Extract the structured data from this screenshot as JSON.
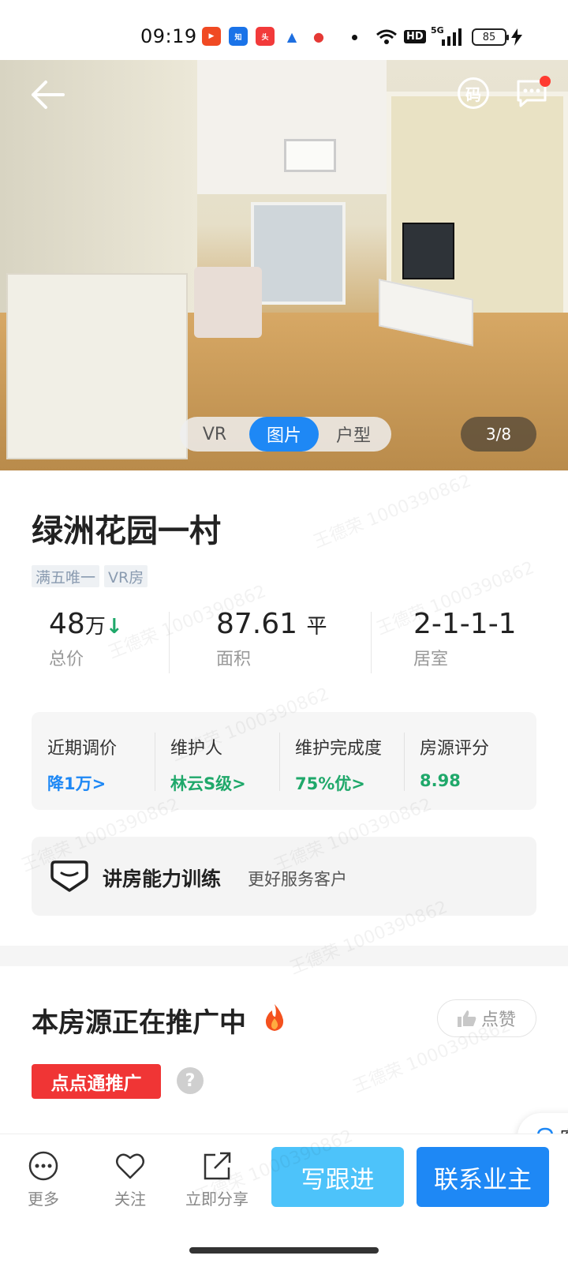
{
  "status_bar": {
    "time": "09:19",
    "app_icons": [
      "video-icon",
      "zhihu-icon",
      "toutiao-icon",
      "a-icon",
      "map-pin-icon"
    ],
    "network": "HD",
    "signal": "5G",
    "battery": "85"
  },
  "gallery": {
    "tabs": [
      "VR",
      "图片",
      "户型"
    ],
    "active_tab": "图片",
    "counter": "3/8",
    "qr_label": "码"
  },
  "listing": {
    "title": "绿洲花园一村",
    "tags": [
      "满五唯一",
      "VR房"
    ],
    "price": {
      "value": "48",
      "unit": "万",
      "label": "总价"
    },
    "area": {
      "value": "87.61",
      "unit": "平",
      "label": "面积"
    },
    "layout": {
      "value": "2-1-1-1",
      "label": "居室"
    }
  },
  "info_card": [
    {
      "label": "近期调价",
      "value": "降1万>",
      "color": "#1e88f5"
    },
    {
      "label": "维护人",
      "value": "林云S级>",
      "color": "#1fa86a"
    },
    {
      "label": "维护完成度",
      "value": "75%优>",
      "color": "#1fa86a"
    },
    {
      "label": "房源评分",
      "value": "8.98",
      "color": "#1fa86a"
    }
  ],
  "training": {
    "title": "讲房能力训练",
    "subtitle": "更好服务客户"
  },
  "promotion": {
    "title": "本房源正在推广中",
    "like_label": "点赞",
    "tag": "点点通推广",
    "help": "?"
  },
  "customer_service": {
    "label": "客"
  },
  "bottom_bar": {
    "more": "更多",
    "follow": "关注",
    "share": "立即分享",
    "follow_up": "写跟进",
    "contact_owner": "联系业主"
  },
  "watermark": "王德荣 1000390862",
  "colors": {
    "primary": "#1e88f5",
    "light_blue": "#4dc3fa",
    "green": "#1fa86a",
    "red": "#f03535"
  }
}
